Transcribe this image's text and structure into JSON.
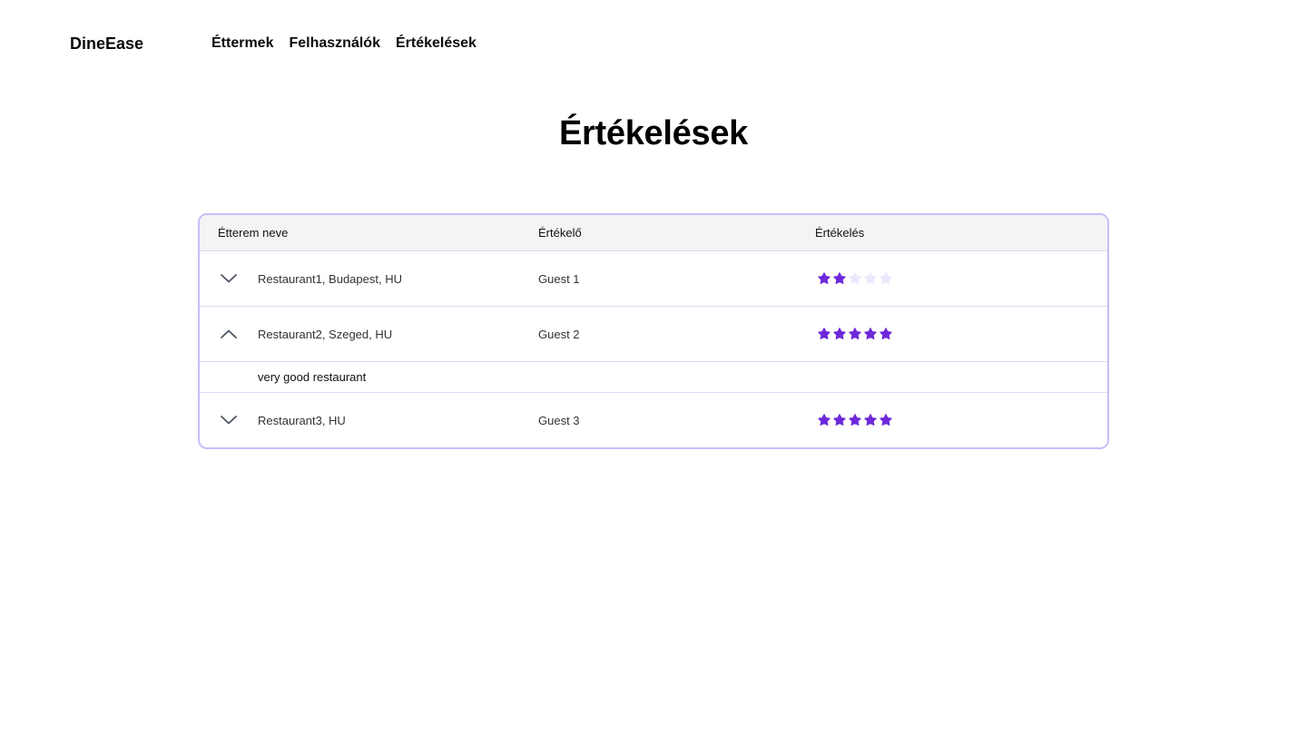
{
  "header": {
    "brand": "DineEase",
    "nav": [
      {
        "label": "Éttermek"
      },
      {
        "label": "Felhasználók"
      },
      {
        "label": "Értékelések"
      }
    ]
  },
  "page": {
    "title": "Értékelések"
  },
  "table": {
    "columns": [
      "Étterem neve",
      "Értékelő",
      "Értékelés"
    ],
    "rows": [
      {
        "restaurant": "Restaurant1, Budapest, HU",
        "rater": "Guest 1",
        "rating": 2,
        "max_rating": 5,
        "expanded": false,
        "comment": ""
      },
      {
        "restaurant": "Restaurant2, Szeged, HU",
        "rater": "Guest 2",
        "rating": 5,
        "max_rating": 5,
        "expanded": true,
        "comment": "very good restaurant"
      },
      {
        "restaurant": "Restaurant3,  HU",
        "rater": "Guest 3",
        "rating": 5,
        "max_rating": 5,
        "expanded": false,
        "comment": ""
      }
    ]
  },
  "colors": {
    "accent": "#6d28d9",
    "star_filled": "#6d28d9",
    "star_empty": "#ede7fd",
    "card_border": "#c7bdfa",
    "header_bg": "#f4f4f5"
  },
  "icons": {
    "collapsed": "chevron-down-icon",
    "expanded": "chevron-up-icon",
    "rating": "star-icon"
  }
}
